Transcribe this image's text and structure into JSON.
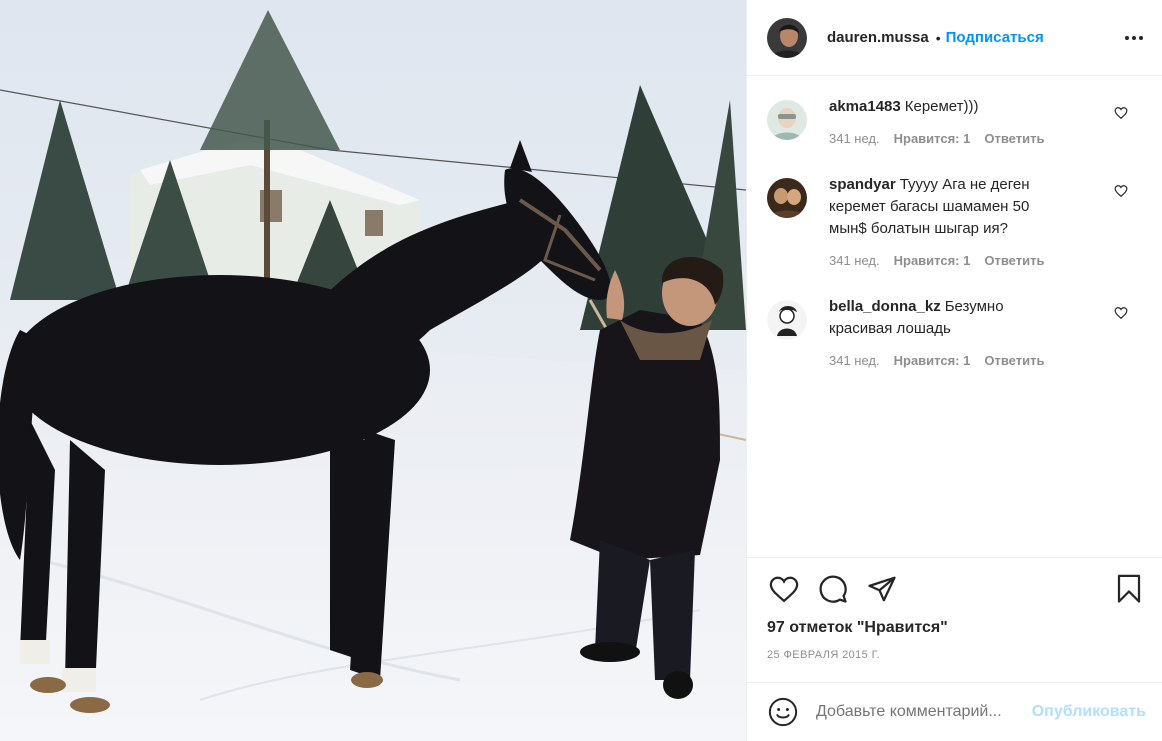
{
  "post": {
    "author": "dauren.mussa",
    "dot": "•",
    "follow_label": "Подписаться",
    "likes_text": "97 отметок \"Нравится\"",
    "date": "25 ФЕВРАЛЯ 2015 Г."
  },
  "comments": [
    {
      "username": "akma1483",
      "text": "Керемет)))",
      "age": "341 нед.",
      "likes": "Нравится: 1",
      "reply_label": "Ответить"
    },
    {
      "username": "spandyar",
      "text": "Туууу Ага не деген керемет багасы шамамен 50 мын$ болатын шыгар ия?",
      "age": "341 нед.",
      "likes": "Нравится: 1",
      "reply_label": "Ответить"
    },
    {
      "username": "bella_donna_kz",
      "text": "Безумно красивая лошадь",
      "age": "341 нед.",
      "likes": "Нравится: 1",
      "reply_label": "Ответить"
    }
  ],
  "composer": {
    "placeholder": "Добавьте комментарий...",
    "publish_label": "Опубликовать"
  },
  "icons": {
    "more": "more-icon",
    "like": "heart-icon",
    "comment": "comment-icon",
    "share": "send-icon",
    "save": "bookmark-icon",
    "emoji": "emoji-icon"
  },
  "colors": {
    "accent": "#0095f6",
    "publish_disabled": "#b2dffc",
    "muted": "#8e8e8e",
    "text": "#262626"
  }
}
